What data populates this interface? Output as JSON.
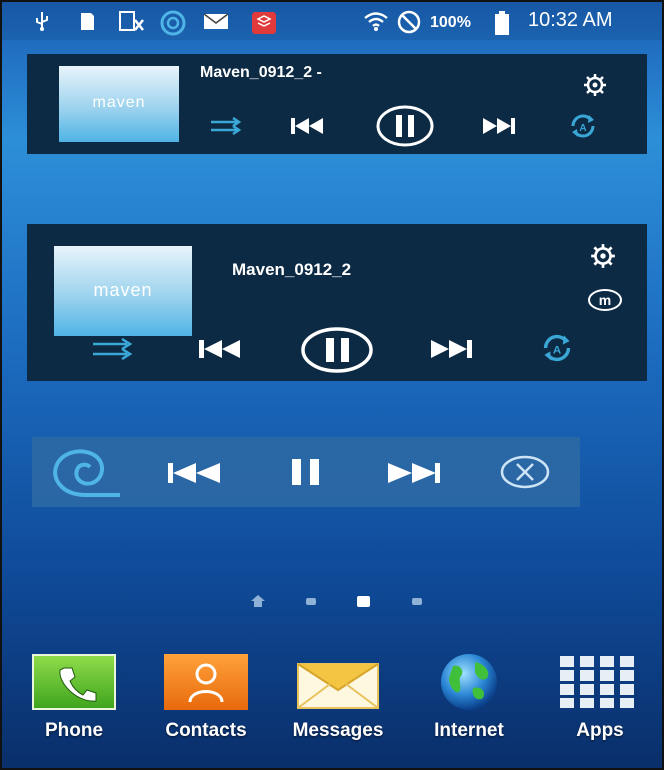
{
  "status_bar": {
    "battery_percent": "100%",
    "time": "10:32 AM",
    "icons": [
      "usb-icon",
      "sd-card-icon",
      "excel-icon",
      "maven-icon",
      "email-icon",
      "app-icon",
      "wifi-icon",
      "do-not-disturb-icon",
      "battery-icon"
    ]
  },
  "widget_small": {
    "title": "Maven_0912_2 -",
    "album_text": "maven",
    "controls": [
      "shuffle-icon",
      "previous-icon",
      "pause-icon",
      "next-icon",
      "repeat-icon"
    ],
    "settings_icon": "gear-icon"
  },
  "widget_large": {
    "title": "Maven_0912_2",
    "album_text": "maven",
    "controls": [
      "shuffle-icon",
      "previous-icon",
      "pause-icon",
      "next-icon",
      "repeat-icon"
    ],
    "settings_icon": "gear-icon",
    "mode_icon": "m-circle-icon"
  },
  "widget_mini": {
    "controls": [
      "maven-logo-icon",
      "previous-icon",
      "pause-icon",
      "next-icon",
      "close-icon"
    ]
  },
  "page_indicator": {
    "pages": 4,
    "current_page": 3
  },
  "dock": {
    "items": [
      {
        "label": "Phone",
        "icon": "phone-icon"
      },
      {
        "label": "Contacts",
        "icon": "contacts-icon"
      },
      {
        "label": "Messages",
        "icon": "messages-icon"
      },
      {
        "label": "Internet",
        "icon": "globe-icon"
      },
      {
        "label": "Apps",
        "icon": "apps-grid-icon"
      }
    ]
  },
  "colors": {
    "accent": "#3aa7d6",
    "widget_bg": "#0d2a44",
    "mini_widget_bg": "#2e6aa3"
  }
}
